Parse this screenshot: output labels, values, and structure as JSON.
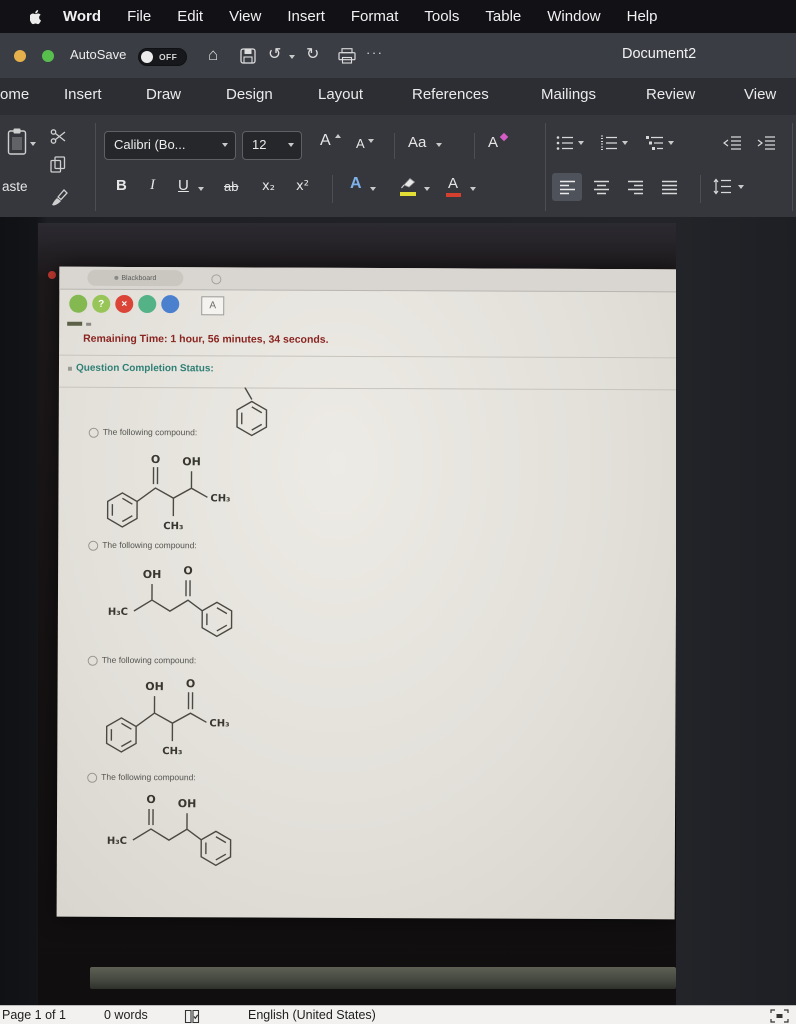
{
  "menubar": {
    "items": [
      "Word",
      "File",
      "Edit",
      "View",
      "Insert",
      "Format",
      "Tools",
      "Table",
      "Window",
      "Help"
    ]
  },
  "titlebar": {
    "autosave": "AutoSave",
    "autosave_state": "OFF",
    "more": "···",
    "title": "Document2"
  },
  "ribbon": {
    "tabs": [
      "ome",
      "Insert",
      "Draw",
      "Design",
      "Layout",
      "References",
      "Mailings",
      "Review",
      "View"
    ],
    "paste": "aste",
    "font_name": "Calibri (Bo...",
    "font_size": "12",
    "grow_font": "A",
    "shrink_font": "A",
    "change_case": "Aa",
    "clear_formatting": "A",
    "bold": "B",
    "italic": "I",
    "underline": "U",
    "strikethrough": "ab",
    "subscript": "x₂",
    "superscript": "x²",
    "text_effects": "A",
    "font_color": "A"
  },
  "photo": {
    "browser_tab": "Blackboard",
    "toolbar_button": "A",
    "remaining_time": "Remaining Time: 1 hour, 56 minutes, 34 seconds.",
    "completion_status": "Question Completion Status:",
    "options": [
      "The following compound:",
      "The following compound:",
      "The following compound:",
      "The following compound:"
    ],
    "atoms": {
      "o": "O",
      "oh": "OH",
      "ch3": "CH₃",
      "h3c": "H₃C"
    }
  },
  "statusbar": {
    "page": "Page 1 of 1",
    "words": "0 words",
    "language": "English (United States)"
  }
}
